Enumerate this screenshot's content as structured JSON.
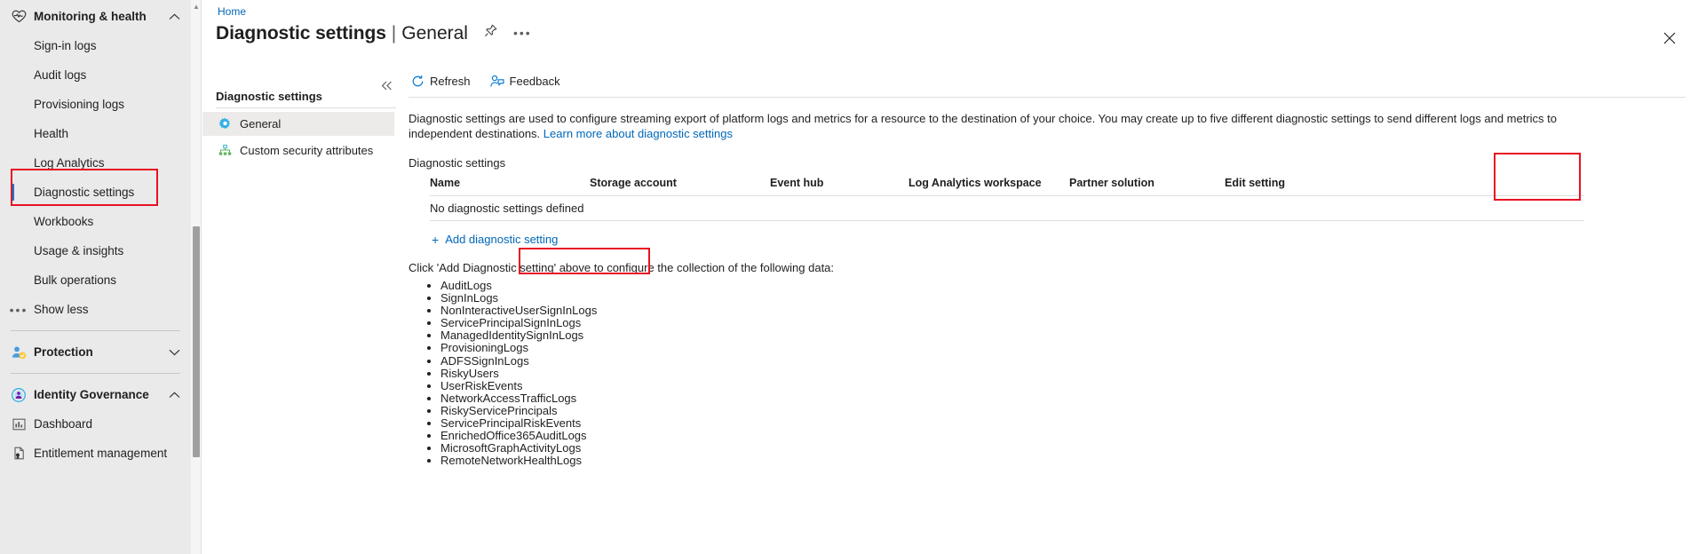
{
  "portal_nav": {
    "sections": [
      {
        "type": "group",
        "label": "Monitoring & health",
        "icon": "heart-pulse-icon",
        "expanded": true,
        "chevron": "chevron-up-icon"
      },
      {
        "type": "item",
        "label": "Sign-in logs",
        "icon": "none"
      },
      {
        "type": "item",
        "label": "Audit logs",
        "icon": "none"
      },
      {
        "type": "item",
        "label": "Provisioning logs",
        "icon": "none"
      },
      {
        "type": "item",
        "label": "Health",
        "icon": "none"
      },
      {
        "type": "item",
        "label": "Log Analytics",
        "icon": "none"
      },
      {
        "type": "item",
        "label": "Diagnostic settings",
        "icon": "none",
        "selected": true
      },
      {
        "type": "item",
        "label": "Workbooks",
        "icon": "none"
      },
      {
        "type": "item",
        "label": "Usage & insights",
        "icon": "none"
      },
      {
        "type": "item",
        "label": "Bulk operations",
        "icon": "none"
      },
      {
        "type": "item",
        "label": "Show less",
        "icon": "ellipsis-icon"
      },
      {
        "type": "separator"
      },
      {
        "type": "group",
        "label": "Protection",
        "icon": "shield-person-icon",
        "expanded": false,
        "chevron": "chevron-down-icon"
      },
      {
        "type": "separator"
      },
      {
        "type": "group",
        "label": "Identity Governance",
        "icon": "governance-icon",
        "expanded": true,
        "chevron": "chevron-up-icon"
      },
      {
        "type": "item",
        "label": "Dashboard",
        "icon": "chart-icon"
      },
      {
        "type": "item",
        "label": "Entitlement management",
        "icon": "document-icon"
      }
    ]
  },
  "header": {
    "breadcrumb": "Home",
    "title": "Diagnostic settings",
    "title_separator": "|",
    "title_subtitle": "General",
    "pin_icon": "pin-icon",
    "more_icon": "ellipsis-icon",
    "close_icon": "close-icon"
  },
  "inner_menu": {
    "collapse_icon": "chevron-double-left-icon",
    "heading": "Diagnostic settings",
    "items": [
      {
        "label": "General",
        "icon": "gear-icon",
        "active": true
      },
      {
        "label": "Custom security attributes",
        "icon": "hierarchy-icon",
        "active": false
      }
    ]
  },
  "toolbar": {
    "refresh_label": "Refresh",
    "refresh_icon": "refresh-icon",
    "feedback_label": "Feedback",
    "feedback_icon": "feedback-person-icon"
  },
  "description": {
    "text_before_link": "Diagnostic settings are used to configure streaming export of platform logs and metrics for a resource to the destination of your choice. You may create up to five different diagnostic settings to send different logs and metrics to independent destinations. ",
    "link_text": "Learn more about diagnostic settings"
  },
  "table": {
    "section_label": "Diagnostic settings",
    "columns": [
      "Name",
      "Storage account",
      "Event hub",
      "Log Analytics workspace",
      "Partner solution",
      "Edit setting"
    ],
    "empty_message": "No diagnostic settings defined"
  },
  "add_button": {
    "plus": "+",
    "label": "Add diagnostic setting",
    "icon": "plus-icon"
  },
  "instruction": "Click 'Add Diagnostic setting' above to configure the collection of the following data:",
  "log_categories": [
    "AuditLogs",
    "SignInLogs",
    "NonInteractiveUserSignInLogs",
    "ServicePrincipalSignInLogs",
    "ManagedIdentitySignInLogs",
    "ProvisioningLogs",
    "ADFSSignInLogs",
    "RiskyUsers",
    "UserRiskEvents",
    "NetworkAccessTrafficLogs",
    "RiskyServicePrincipals",
    "ServicePrincipalRiskEvents",
    "EnrichedOffice365AuditLogs",
    "MicrosoftGraphActivityLogs",
    "RemoteNetworkHealthLogs"
  ],
  "annotations": {
    "highlight_color": "#e81123",
    "boxes": [
      {
        "name": "diagnostic-settings-nav-highlight"
      },
      {
        "name": "edit-setting-column-highlight"
      },
      {
        "name": "add-diagnostic-setting-highlight"
      }
    ]
  }
}
